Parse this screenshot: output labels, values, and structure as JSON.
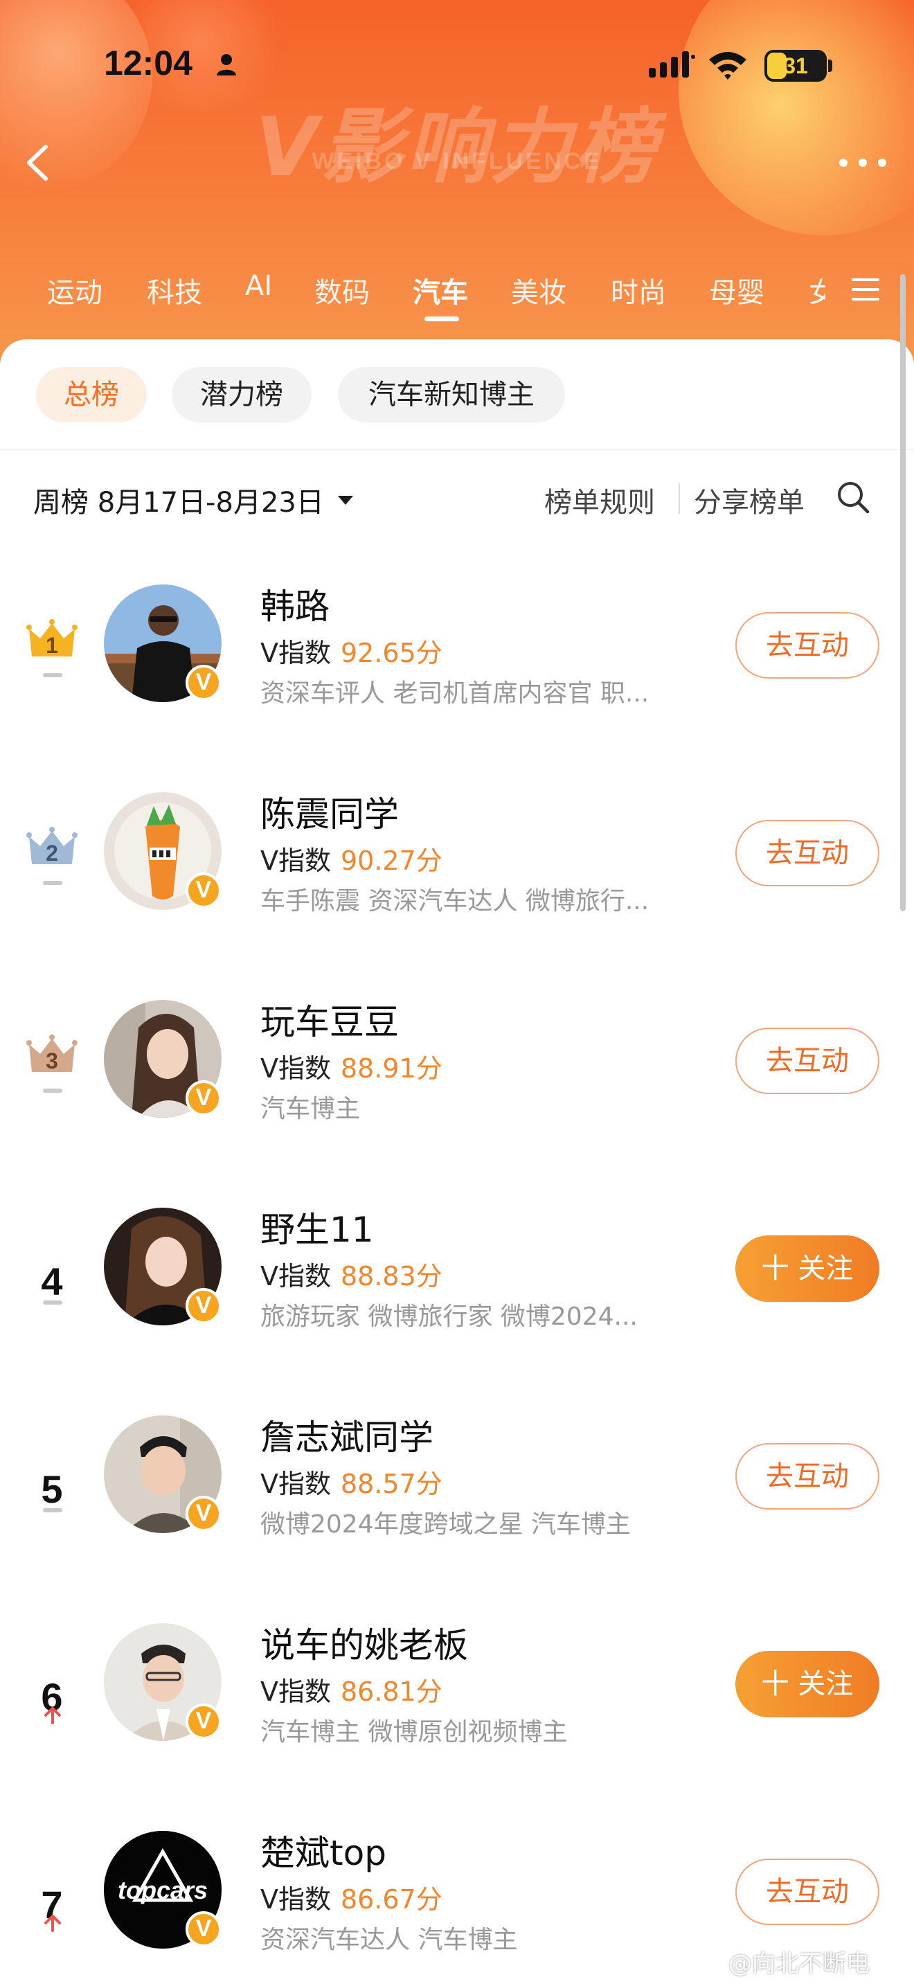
{
  "status_bar": {
    "time": "12:04",
    "battery": "31"
  },
  "header": {
    "title": "V影响力榜",
    "subtitle": "WEIBO V INFLUENCE"
  },
  "tabs": [
    {
      "label": "运动"
    },
    {
      "label": "科技"
    },
    {
      "label": "AI"
    },
    {
      "label": "数码"
    },
    {
      "label": "汽车"
    },
    {
      "label": "美妆"
    },
    {
      "label": "时尚"
    },
    {
      "label": "母婴"
    },
    {
      "label": "女"
    }
  ],
  "active_tab": "汽车",
  "subtabs": [
    {
      "label": "总榜"
    },
    {
      "label": "潜力榜"
    },
    {
      "label": "汽车新知博主"
    }
  ],
  "period": {
    "label": "周榜 8月17日-8月23日"
  },
  "links": {
    "rules": "榜单规则",
    "share": "分享榜单"
  },
  "colors": {
    "accent": "#f36f22",
    "score": "#f3862a",
    "header_top": "#f6622a",
    "header_bottom": "#f79a4e",
    "badge": "#f5a51f"
  },
  "v_label": "V指数",
  "rankings": [
    {
      "rank": "1",
      "name": "韩路",
      "score": "92.65分",
      "desc": "资深车评人 老司机首席内容官 职...",
      "action": "去互动",
      "trend": "flat"
    },
    {
      "rank": "2",
      "name": "陈震同学",
      "score": "90.27分",
      "desc": "车手陈震 资深汽车达人 微博旅行...",
      "action": "去互动",
      "trend": "flat"
    },
    {
      "rank": "3",
      "name": "玩车豆豆",
      "score": "88.91分",
      "desc": "汽车博主",
      "action": "去互动",
      "trend": "flat"
    },
    {
      "rank": "4",
      "name": "野生11",
      "score": "88.83分",
      "desc": "旅游玩家 微博旅行家 微博2024...",
      "action": "十 关注",
      "trend": "flat"
    },
    {
      "rank": "5",
      "name": "詹志斌同学",
      "score": "88.57分",
      "desc": "微博2024年度跨域之星 汽车博主",
      "action": "去互动",
      "trend": "flat"
    },
    {
      "rank": "6",
      "name": "说车的姚老板",
      "score": "86.81分",
      "desc": "汽车博主 微博原创视频博主",
      "action": "十 关注",
      "trend": "up"
    },
    {
      "rank": "7",
      "name": "楚斌top",
      "score": "86.67分",
      "desc": "资深汽车达人 汽车博主",
      "action": "去互动",
      "trend": "up"
    }
  ],
  "avatar_texts": {
    "topcars": "topcars"
  },
  "watermark": "@向北不断电"
}
